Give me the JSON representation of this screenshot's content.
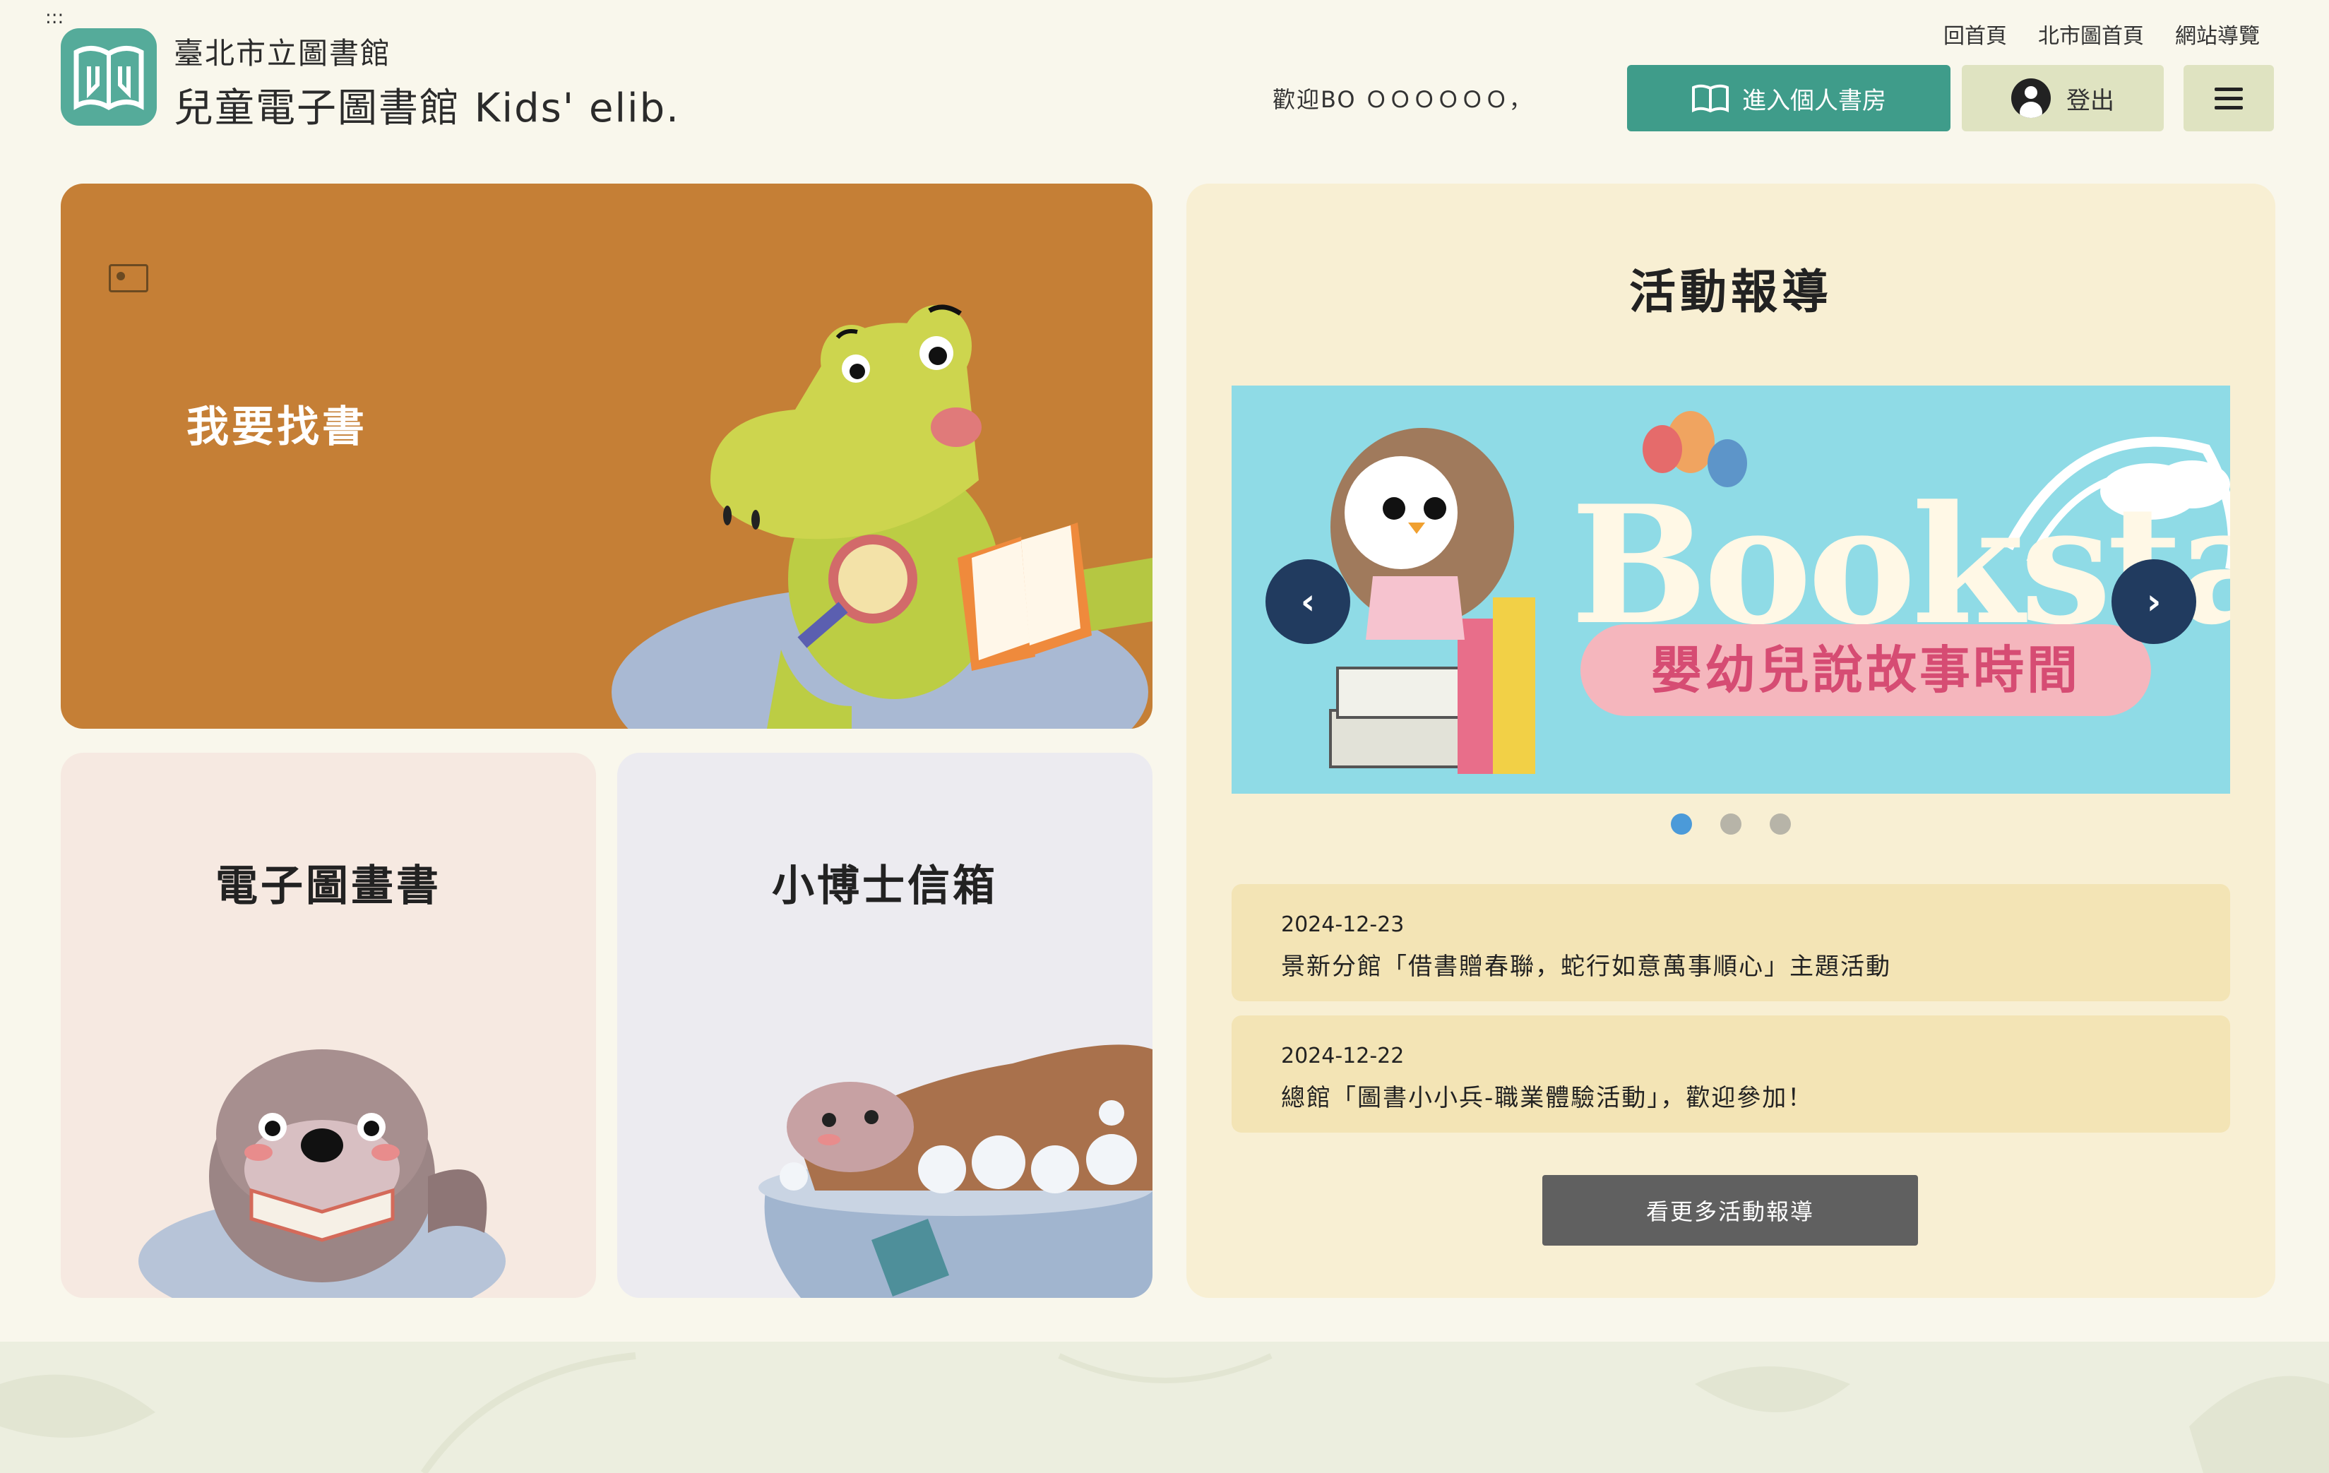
{
  "a11y_marker": ":::",
  "header": {
    "org_name": "臺北市立圖書館",
    "site_name": "兒童電子圖書館 Kids' elib.",
    "top_links": [
      "回首頁",
      "北市圖首頁",
      "網站導覽"
    ],
    "welcome": "歡迎BO ＯＯＯＯＯＯ，",
    "bookroom_label": "進入個人書房",
    "logout_label": "登出"
  },
  "cards": {
    "find_books": "我要找書",
    "picture_books": "電子圖畫書",
    "mailbox": "小博士信箱"
  },
  "news": {
    "heading": "活動報導",
    "banner": {
      "title": "Bookstart",
      "subtitle": "嬰幼兒說故事時間"
    },
    "slide_count": 3,
    "active_slide": 1,
    "items": [
      {
        "date": "2024-12-23",
        "title": "景新分館「借書贈春聯，蛇行如意萬事順心」主題活動"
      },
      {
        "date": "2024-12-22",
        "title": "總館「圖書小小兵-職業體驗活動」，歡迎參加！"
      }
    ],
    "more_label": "看更多活動報導"
  },
  "colors": {
    "page_bg": "#f9f7ec",
    "primary_green": "#3f9c8a",
    "find_card": "#c57f36",
    "news_panel": "#f8efd3",
    "carousel_arrow": "#213b5f",
    "active_dot": "#4b9ad9"
  },
  "icons": [
    "logo-icon",
    "open-book-icon",
    "user-avatar-icon",
    "hamburger-menu-icon",
    "image-icon",
    "chevron-left-icon",
    "chevron-right-icon"
  ]
}
